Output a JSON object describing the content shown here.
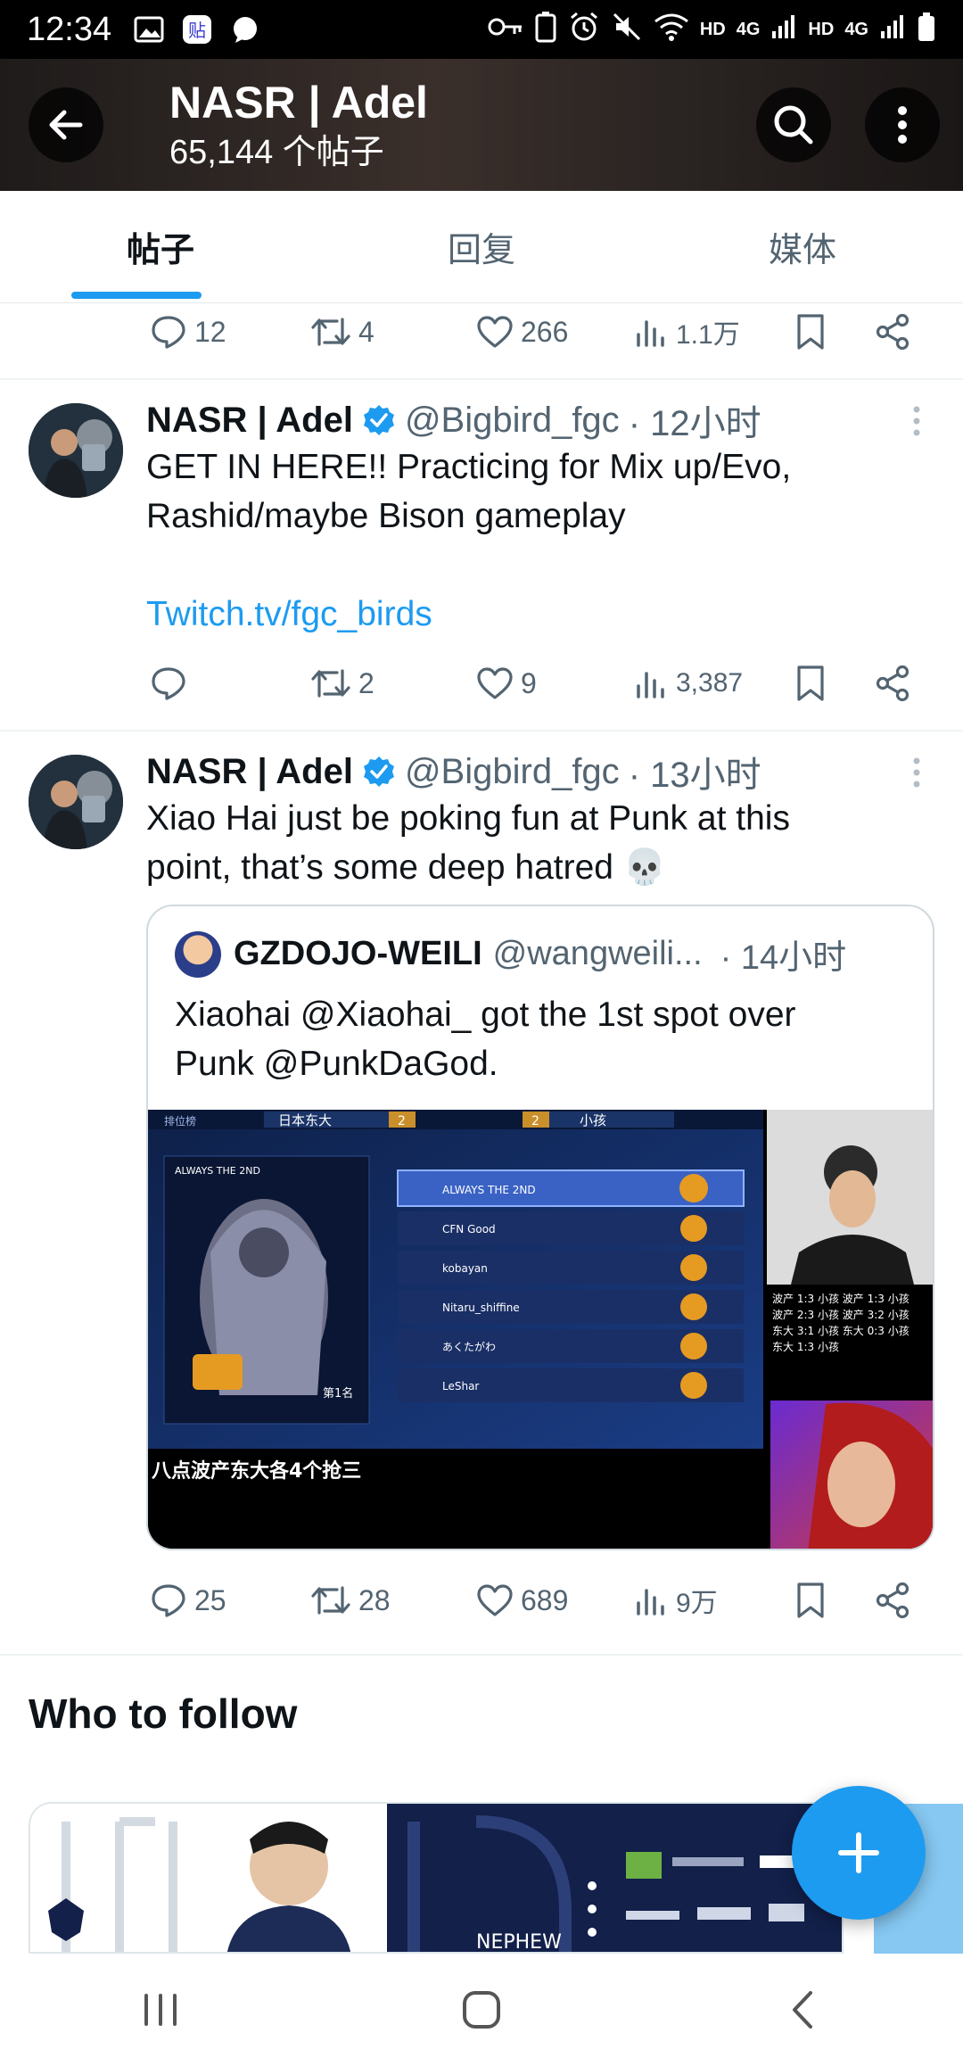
{
  "status_bar": {
    "time": "12:34",
    "network_left": "HD",
    "network_4g_1": "4G",
    "network_right": "HD",
    "network_4g_2": "4G"
  },
  "header": {
    "title": "NASR | Adel",
    "post_count": "65,144 个帖子"
  },
  "tabs": [
    {
      "label": "帖子",
      "active": true
    },
    {
      "label": "回复",
      "active": false
    },
    {
      "label": "媒体",
      "active": false
    }
  ],
  "tweets": [
    {
      "actions": {
        "replies": "12",
        "reposts": "4",
        "likes": "266",
        "views": "1.1万"
      }
    },
    {
      "name": "NASR | Adel",
      "handle": "@Bigbird_fgc",
      "time": "· 12小时",
      "text_line1": "GET IN HERE!! Practicing for Mix up/Evo,",
      "text_line2": "Rashid/maybe Bison gameplay",
      "link": "Twitch.tv/fgc_birds",
      "actions": {
        "replies": "",
        "reposts": "2",
        "likes": "9",
        "views": "3,387"
      }
    },
    {
      "name": "NASR | Adel",
      "handle": "@Bigbird_fgc",
      "time": "· 13小时",
      "text_line1": "Xiao Hai just be poking fun at Punk at this",
      "text_line2": "point, that’s some deep hatred 💀",
      "quote": {
        "name": "GZDOJO-WEILI",
        "handle": "@wangweili...",
        "time": "· 14小时",
        "text_line1": "Xiaohai @Xiaohai_ got the 1st spot over",
        "text_line2": "Punk @PunkDaGod.",
        "media_caption": "八点波产东大各4个抢三",
        "team_left": "日本东大",
        "team_right": "小孩",
        "score_left": "2",
        "score_right": "2",
        "leaderboard_tab": "排位榜",
        "rank_label": "第1名",
        "player_label": "ALWAYS THE 2ND",
        "entries": [
          "ALWAYS THE 2ND",
          "CFN Good",
          "kobayan",
          "Nitaru_shiffine",
          "あくたがわ",
          "LeShar"
        ],
        "overlay_lines": [
          "波产 1:3 小孩 波产 1:3 小孩",
          "波产 2:3 小孩 波产 3:2 小孩",
          "东大 3:1 小孩 东大 0:3 小孩",
          "东大 1:3 小孩"
        ]
      },
      "actions": {
        "replies": "25",
        "reposts": "28",
        "likes": "689",
        "views": "9万"
      }
    }
  ],
  "who_to_follow": {
    "title": "Who to follow",
    "promo_name": "NEPHEW"
  },
  "colors": {
    "accent": "#1d9bf0",
    "text_primary": "#0f1419",
    "text_secondary": "#536471"
  }
}
